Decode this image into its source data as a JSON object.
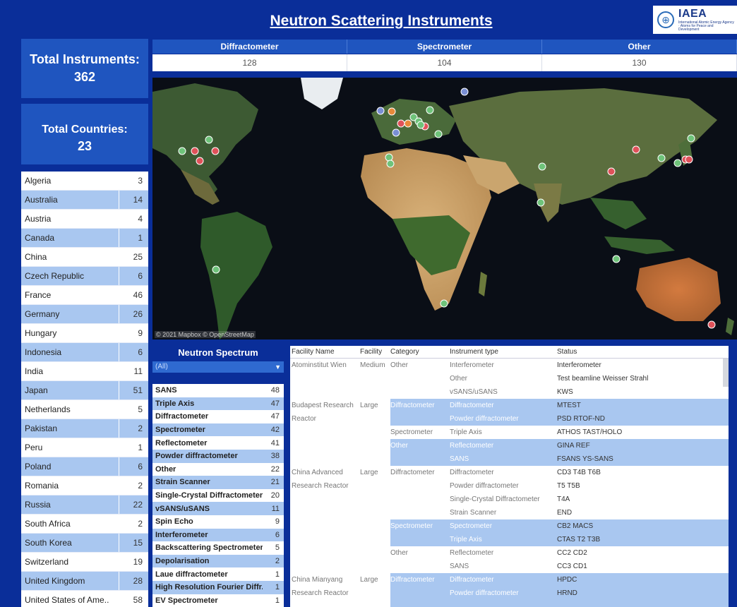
{
  "title": "Neutron Scattering Instruments",
  "logo": {
    "brand": "IAEA",
    "sub": "International Atomic Energy Agency · Atoms for Peace and Development"
  },
  "kpis": {
    "instruments_label": "Total Instruments:",
    "instruments_value": "362",
    "countries_label": "Total Countries:",
    "countries_value": "23"
  },
  "categories": [
    {
      "label": "Diffractometer",
      "count": "128"
    },
    {
      "label": "Spectrometer",
      "count": "104"
    },
    {
      "label": "Other",
      "count": "130"
    }
  ],
  "countries": [
    {
      "name": "Algeria",
      "count": "3"
    },
    {
      "name": "Australia",
      "count": "14"
    },
    {
      "name": "Austria",
      "count": "4"
    },
    {
      "name": "Canada",
      "count": "1"
    },
    {
      "name": "China",
      "count": "25"
    },
    {
      "name": "Czech Republic",
      "count": "6"
    },
    {
      "name": "France",
      "count": "46"
    },
    {
      "name": "Germany",
      "count": "26"
    },
    {
      "name": "Hungary",
      "count": "9"
    },
    {
      "name": "Indonesia",
      "count": "6"
    },
    {
      "name": "India",
      "count": "11"
    },
    {
      "name": "Japan",
      "count": "51"
    },
    {
      "name": "Netherlands",
      "count": "5"
    },
    {
      "name": "Pakistan",
      "count": "2"
    },
    {
      "name": "Peru",
      "count": "1"
    },
    {
      "name": "Poland",
      "count": "6"
    },
    {
      "name": "Romania",
      "count": "2"
    },
    {
      "name": "Russia",
      "count": "22"
    },
    {
      "name": "South Africa",
      "count": "2"
    },
    {
      "name": "South Korea",
      "count": "15"
    },
    {
      "name": "Switzerland",
      "count": "19"
    },
    {
      "name": "United Kingdom",
      "count": "28"
    },
    {
      "name": "United States of Ame..",
      "count": "58"
    }
  ],
  "map": {
    "credit": "© 2021 Mapbox © OpenStreetMap",
    "marker_colors": {
      "green": "#6fc37a",
      "red": "#e0525a",
      "orange": "#e8893a",
      "blue": "#7a8fd4"
    }
  },
  "spectrum": {
    "title": "Neutron Spectrum",
    "selected": "(All)",
    "items": [
      {
        "name": "SANS",
        "count": "48"
      },
      {
        "name": "Triple Axis",
        "count": "47"
      },
      {
        "name": "Diffractometer",
        "count": "47"
      },
      {
        "name": "Spectrometer",
        "count": "42"
      },
      {
        "name": "Reflectometer",
        "count": "41"
      },
      {
        "name": "Powder diffractometer",
        "count": "38"
      },
      {
        "name": "Other",
        "count": "22"
      },
      {
        "name": "Strain Scanner",
        "count": "21"
      },
      {
        "name": "Single-Crystal Diffractometer",
        "count": "20"
      },
      {
        "name": "vSANS/uSANS",
        "count": "11"
      },
      {
        "name": "Spin Echo",
        "count": "9"
      },
      {
        "name": "Interferometer",
        "count": "6"
      },
      {
        "name": "Backscattering Spectrometer",
        "count": "5"
      },
      {
        "name": "Depolarisation",
        "count": "2"
      },
      {
        "name": "Laue diffractometer",
        "count": "1"
      },
      {
        "name": "High Resolution Fourier Diffr..",
        "count": "1"
      },
      {
        "name": "EV Spectrometer",
        "count": "1"
      }
    ]
  },
  "table": {
    "headers": {
      "facility": "Facility Name",
      "size": "Facility",
      "category": "Category",
      "instrument": "Instrument type",
      "status": "Status"
    },
    "rows": [
      {
        "facility": "Atominstitut Wien",
        "size": "Medium",
        "category": "Other",
        "instrument": "Interferometer",
        "status": "Interferometer",
        "blue": false
      },
      {
        "facility": "",
        "size": "",
        "category": "",
        "instrument": "Other",
        "status": "Test beamline  Weisser Strahl",
        "blue": false
      },
      {
        "facility": "",
        "size": "",
        "category": "",
        "instrument": "vSANS/uSANS",
        "status": "KWS",
        "blue": false
      },
      {
        "facility": "Budapest Research",
        "size": "Large",
        "category": "Diffractometer",
        "instrument": "Diffractometer",
        "status": "MTEST",
        "blue": true
      },
      {
        "facility": "Reactor",
        "size": "",
        "category": "",
        "instrument": "Powder diffractometer",
        "status": "PSD  RTOF-ND",
        "blue": true
      },
      {
        "facility": "",
        "size": "",
        "category": "Spectrometer",
        "instrument": "Triple Axis",
        "status": "ATHOS  TAST/HOLO",
        "blue": false
      },
      {
        "facility": "",
        "size": "",
        "category": "Other",
        "instrument": "Reflectometer",
        "status": "GINA  REF",
        "blue": true
      },
      {
        "facility": "",
        "size": "",
        "category": "",
        "instrument": "SANS",
        "status": "FSANS  YS-SANS",
        "blue": true
      },
      {
        "facility": "China Advanced",
        "size": "Large",
        "category": "Diffractometer",
        "instrument": "Diffractometer",
        "status": "CD3  T4B  T6B",
        "blue": false
      },
      {
        "facility": "Research Reactor",
        "size": "",
        "category": "",
        "instrument": "Powder diffractometer",
        "status": "T5  T5B",
        "blue": false
      },
      {
        "facility": "",
        "size": "",
        "category": "",
        "instrument": "Single-Crystal Diffractometer",
        "status": "T4A",
        "blue": false
      },
      {
        "facility": "",
        "size": "",
        "category": "",
        "instrument": "Strain Scanner",
        "status": "END",
        "blue": false
      },
      {
        "facility": "",
        "size": "",
        "category": "Spectrometer",
        "instrument": "Spectrometer",
        "status": "CB2  MACS",
        "blue": true
      },
      {
        "facility": "",
        "size": "",
        "category": "",
        "instrument": "Triple Axis",
        "status": "CTAS  T2  T3B",
        "blue": true
      },
      {
        "facility": "",
        "size": "",
        "category": "Other",
        "instrument": "Reflectometer",
        "status": "CC2  CD2",
        "blue": false
      },
      {
        "facility": "",
        "size": "",
        "category": "",
        "instrument": "SANS",
        "status": "CC3  CD1",
        "blue": false
      },
      {
        "facility": "China Mianyang",
        "size": "Large",
        "category": "Diffractometer",
        "instrument": "Diffractometer",
        "status": "HPDC",
        "blue": true
      },
      {
        "facility": "Research Reactor",
        "size": "",
        "category": "",
        "instrument": "Powder diffractometer",
        "status": "HRND",
        "blue": true
      },
      {
        "facility": "",
        "size": "",
        "category": "",
        "instrument": "",
        "status": "",
        "blue": true
      }
    ]
  }
}
